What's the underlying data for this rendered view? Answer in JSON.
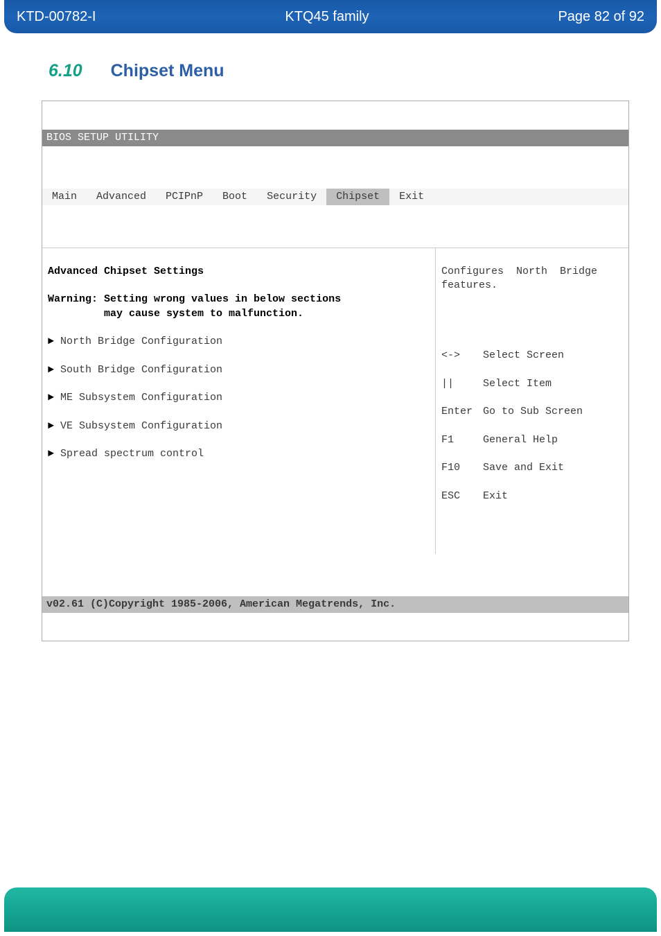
{
  "header": {
    "doc_id": "KTD-00782-I",
    "family": "KTQ45 family",
    "page": "Page 82 of 92"
  },
  "section": {
    "number": "6.10",
    "title": "Chipset Menu"
  },
  "bios": {
    "utility_title": "BIOS SETUP UTILITY",
    "tabs": {
      "main": "Main",
      "advanced": "Advanced",
      "pcipnp": "PCIPnP",
      "boot": "Boot",
      "security": "Security",
      "chipset": "Chipset",
      "exit": "Exit"
    },
    "main_panel": {
      "heading": "Advanced Chipset Settings",
      "warning_l1": "Warning: Setting wrong values in below sections",
      "warning_l2": "         may cause system to malfunction.",
      "items": [
        "North Bridge Configuration",
        "South Bridge Configuration",
        "ME Subsystem Configuration",
        "VE Subsystem Configuration",
        "Spread spectrum control"
      ]
    },
    "side_panel": {
      "desc_l1": "Configures  North  Bridge",
      "desc_l2": "features.",
      "keys": [
        {
          "k": "<->",
          "v": "Select Screen"
        },
        {
          "k": "||",
          "v": "Select Item"
        },
        {
          "k": "Enter",
          "v": "Go to Sub Screen"
        },
        {
          "k": "F1",
          "v": "General Help"
        },
        {
          "k": "F10",
          "v": "Save and Exit"
        },
        {
          "k": "ESC",
          "v": "Exit"
        }
      ]
    },
    "footer": "v02.61 (C)Copyright 1985-2006, American Megatrends, Inc."
  }
}
